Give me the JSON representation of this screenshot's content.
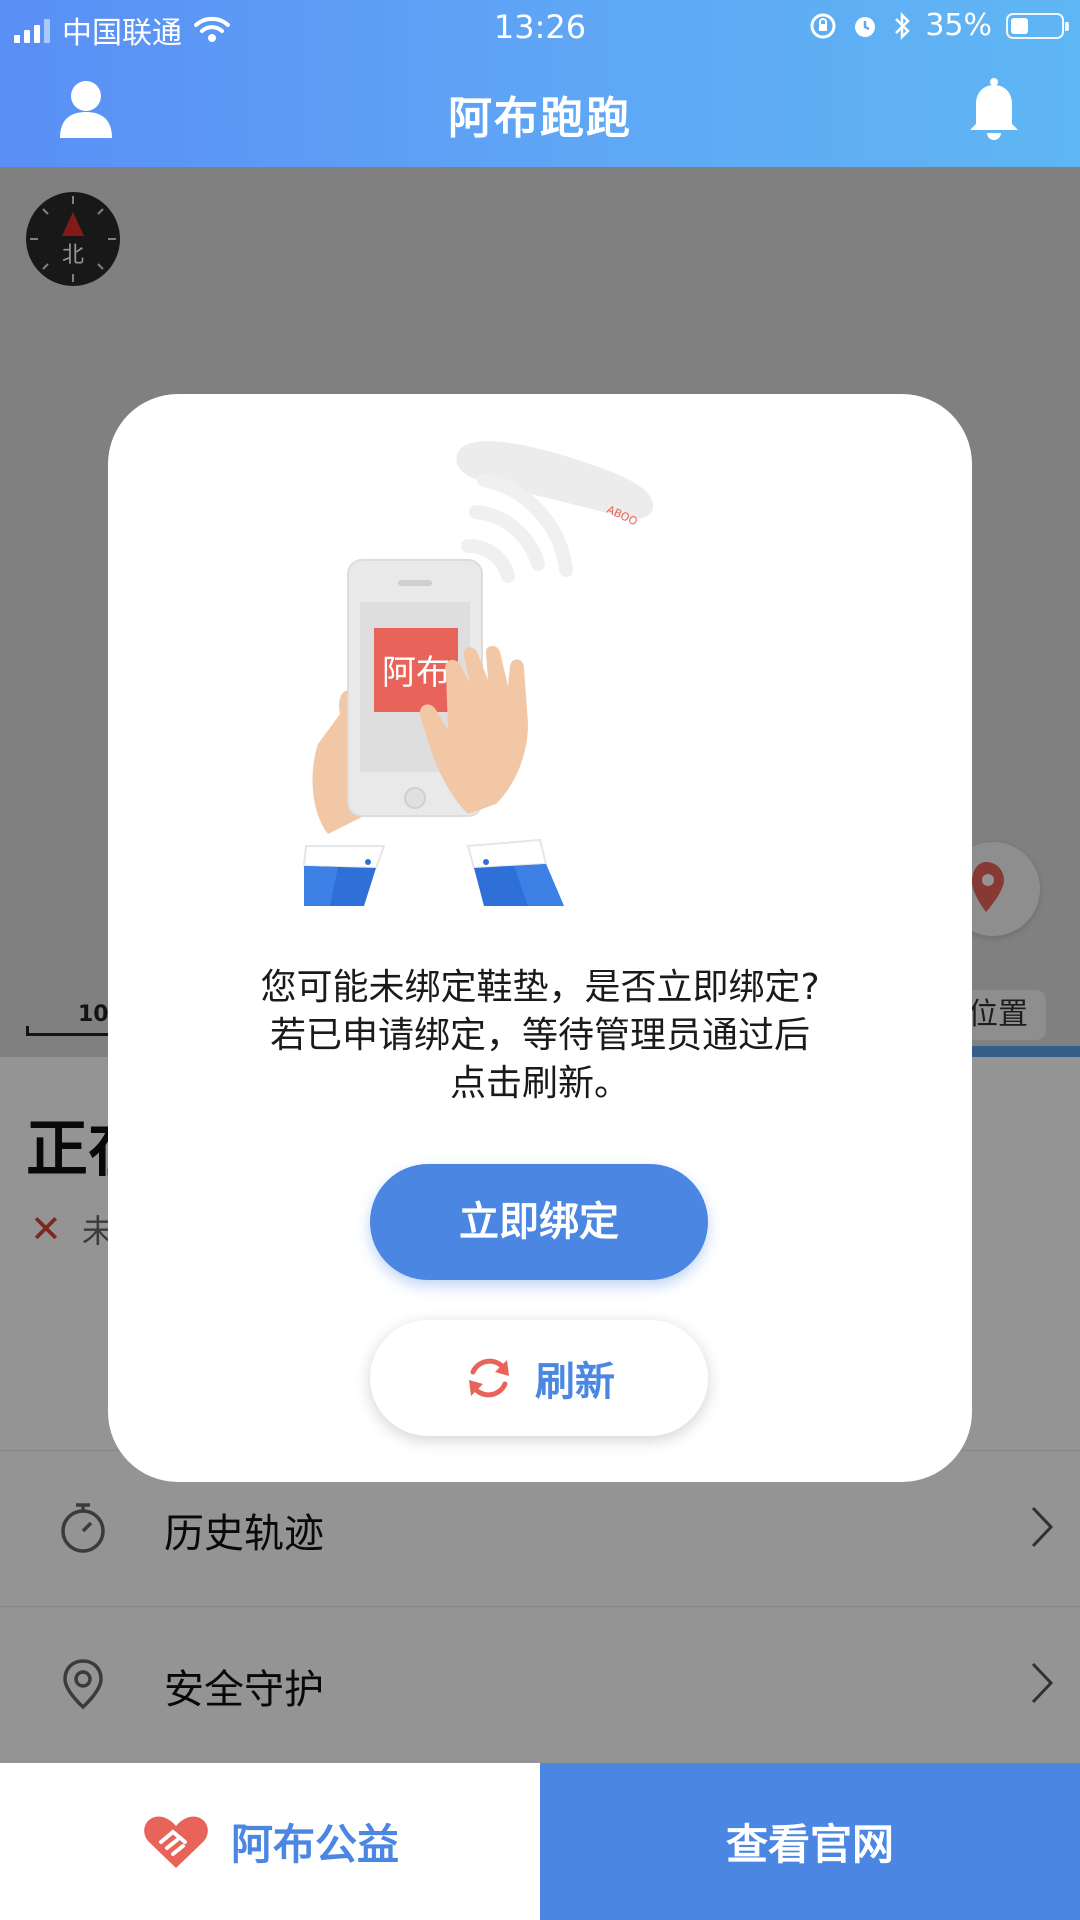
{
  "status_bar": {
    "carrier": "中国联通",
    "time": "13:26",
    "battery": "35%",
    "battery_level": 0.35
  },
  "header": {
    "title": "阿布跑跑",
    "left_icon": "user-icon",
    "right_icon": "bell-icon"
  },
  "map": {
    "compass_label": "北",
    "scale_label": "10",
    "location_chip": "位置"
  },
  "info": {
    "status_title": "正在",
    "status_sub": "未"
  },
  "list": {
    "items": [
      {
        "label": "历史轨迹",
        "icon": "stopwatch-icon"
      },
      {
        "label": "安全守护",
        "icon": "location-pin-icon"
      }
    ]
  },
  "bottom_bar": {
    "left_label": "阿布公益",
    "left_icon": "heart-handshake-icon",
    "right_label": "查看官网"
  },
  "dialog": {
    "phone_brand": "阿布",
    "insole_brand": "ABOO",
    "message_lines": [
      "您可能未绑定鞋垫，是否立即绑定?",
      "若已申请绑定，等待管理员通过后",
      "点击刷新。"
    ],
    "primary_button": "立即绑定",
    "refresh_button": "刷新"
  },
  "colors": {
    "header_gradient_start": "#5a8ff5",
    "header_gradient_end": "#5fb6f4",
    "primary_blue": "#4a86e2",
    "accent_red": "#e8635a"
  }
}
